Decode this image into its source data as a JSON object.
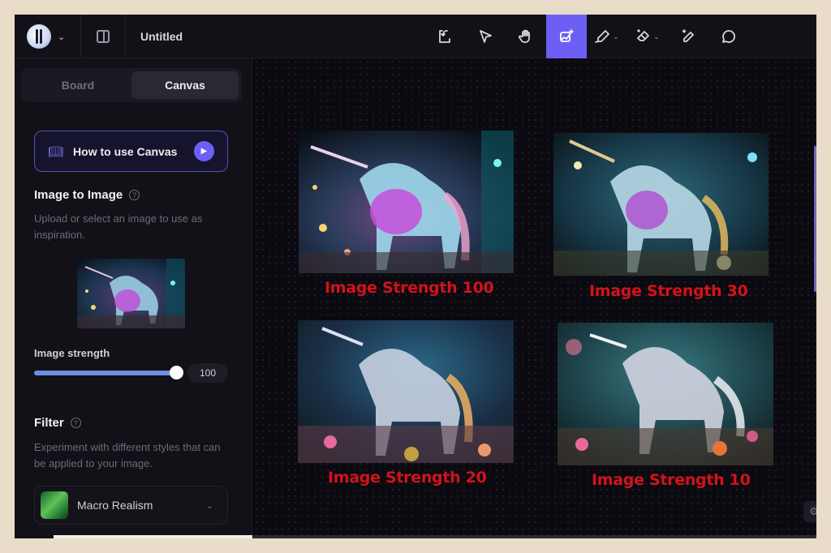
{
  "header": {
    "title": "Untitled",
    "tools": [
      {
        "icon": "import-icon",
        "label": "Import"
      },
      {
        "icon": "select-arrow-icon",
        "label": "Select"
      },
      {
        "icon": "hand-pan-icon",
        "label": "Pan"
      },
      {
        "icon": "image-to-image-icon",
        "label": "Image to Image",
        "active": true
      },
      {
        "icon": "draw-pencil-icon",
        "label": "Draw"
      },
      {
        "icon": "eraser-icon",
        "label": "Erase"
      },
      {
        "icon": "magic-pen-icon",
        "label": "Magic Pen"
      },
      {
        "icon": "comment-icon",
        "label": "Comment"
      }
    ]
  },
  "sidebar": {
    "tabs": [
      {
        "label": "Board",
        "active": false
      },
      {
        "label": "Canvas",
        "active": true
      }
    ],
    "howto_label": "How to use Canvas",
    "img2img": {
      "title": "Image to Image",
      "description": "Upload or select an image to use as inspiration.",
      "strength_label": "Image strength",
      "strength_value": "100",
      "strength_fraction": 1.0
    },
    "filter": {
      "title": "Filter",
      "description": "Experiment with different styles that can be applied to your image.",
      "selected": "Macro Realism"
    }
  },
  "canvas": {
    "captions": [
      "Image Strength 100",
      "Image Strength 30",
      "Image Strength 20",
      "Image Strength 10"
    ],
    "caption_color": "#d4121b"
  },
  "colors": {
    "accent": "#6d5ff5",
    "slider": "#6b8fe0"
  }
}
